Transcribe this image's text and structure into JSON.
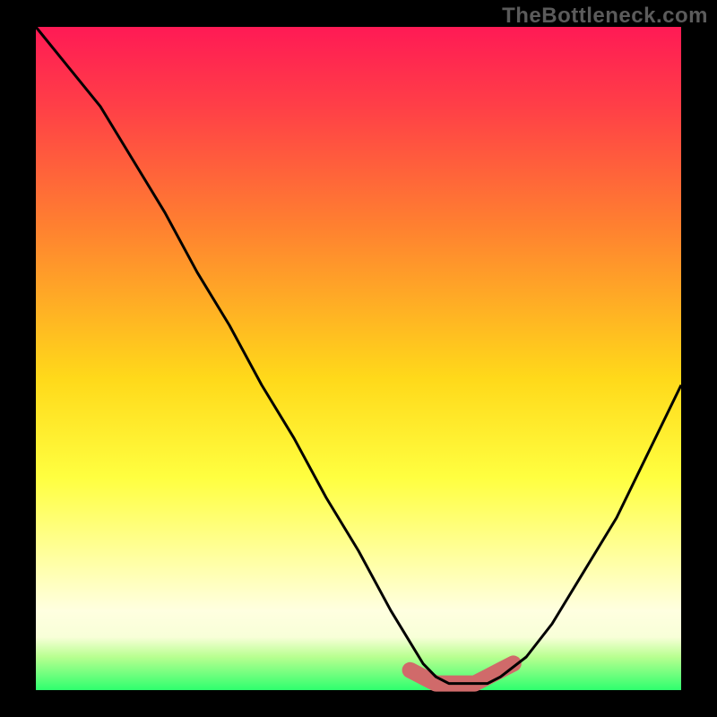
{
  "watermark": "TheBottleneck.com",
  "chart_data": {
    "type": "line",
    "title": "",
    "xlabel": "",
    "ylabel": "",
    "xlim": [
      0,
      100
    ],
    "ylim": [
      0,
      100
    ],
    "grid": false,
    "series": [
      {
        "name": "main-curve",
        "x": [
          0,
          5,
          10,
          15,
          20,
          25,
          30,
          35,
          40,
          45,
          50,
          55,
          60,
          62,
          64,
          66,
          68,
          70,
          72,
          76,
          80,
          85,
          90,
          95,
          100
        ],
        "values": [
          100,
          94,
          88,
          80,
          72,
          63,
          55,
          46,
          38,
          29,
          21,
          12,
          4,
          2,
          1,
          1,
          1,
          1,
          2,
          5,
          10,
          18,
          26,
          36,
          46
        ]
      },
      {
        "name": "highlight-band",
        "x": [
          58,
          60,
          62,
          64,
          66,
          68,
          70,
          72,
          74
        ],
        "values": [
          3,
          2,
          1,
          1,
          1,
          1,
          2,
          3,
          4
        ]
      }
    ]
  }
}
